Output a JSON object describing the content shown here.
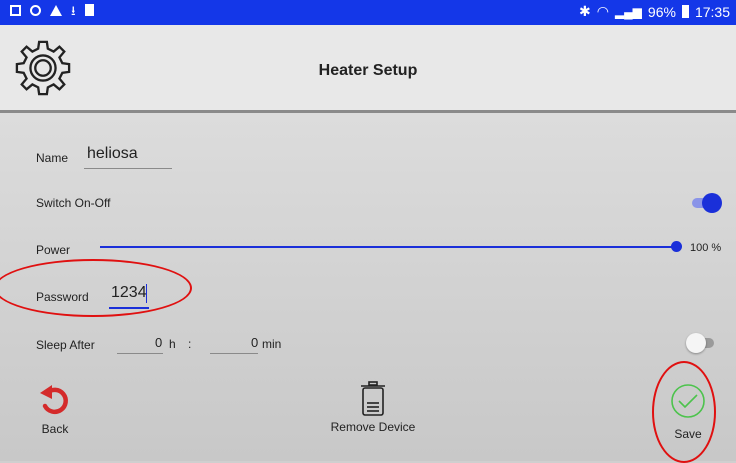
{
  "status_bar": {
    "icons_left": [
      "notification-icon",
      "sync-icon",
      "warning-icon",
      "download-icon",
      "sd-card-icon"
    ],
    "icons_right": [
      "bluetooth-icon",
      "wifi-icon",
      "signal-icon",
      "battery-icon"
    ],
    "battery": "96%",
    "time": "17:35"
  },
  "header": {
    "title": "Heater Setup",
    "icon": "gear-icon"
  },
  "form": {
    "name_label": "Name",
    "name_value": "heliosa",
    "switch_label": "Switch On-Off",
    "switch_on": true,
    "power_label": "Power",
    "power_percent": 100,
    "power_value": "100 %",
    "password_label": "Password",
    "password_value": "1234",
    "sleep_label": "Sleep After",
    "sleep_hours": "0",
    "sleep_hours_unit": "h",
    "sleep_separator": ":",
    "sleep_minutes": "0",
    "sleep_minutes_unit": "min",
    "sleep_on": false
  },
  "actions": {
    "back_label": "Back",
    "remove_label": "Remove Device",
    "save_label": "Save"
  },
  "colors": {
    "status_bar": "#1437e8",
    "accent": "#1a2fd9",
    "back_icon": "#d42a2a",
    "save_icon": "#4cc34c",
    "annotation": "#e01010"
  }
}
